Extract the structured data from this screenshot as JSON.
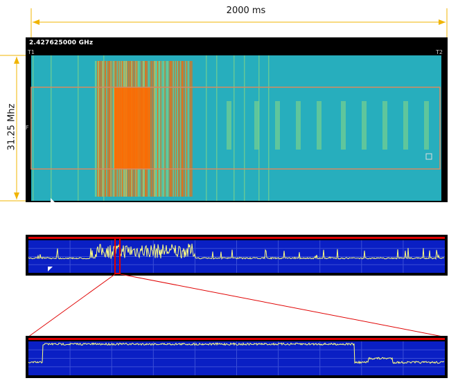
{
  "time_span": {
    "label": "2000 ms"
  },
  "bandwidth": {
    "label": "31.25 Mhz"
  },
  "spectrogram": {
    "center_frequency": "2.427625000 GHz",
    "marker_t1": "T1",
    "marker_t2": "T2",
    "marker_f": "F",
    "colors": {
      "background": "#27aebd",
      "hot": "#ff6a00",
      "warm": "#f3c23a",
      "cool": "#7ed38a",
      "selection": "#d88a60"
    }
  },
  "overview_trace": {
    "background": "#0a1fc4",
    "trace_color": "#ffff80",
    "reference_line_color": "#e00000"
  },
  "zoomed_trace": {
    "background": "#0a1fc4",
    "trace_color": "#ffff80",
    "reference_line_color": "#e00000"
  },
  "dimension_line_color": "#f0b400",
  "zoom_connector_color": "#e00000"
}
